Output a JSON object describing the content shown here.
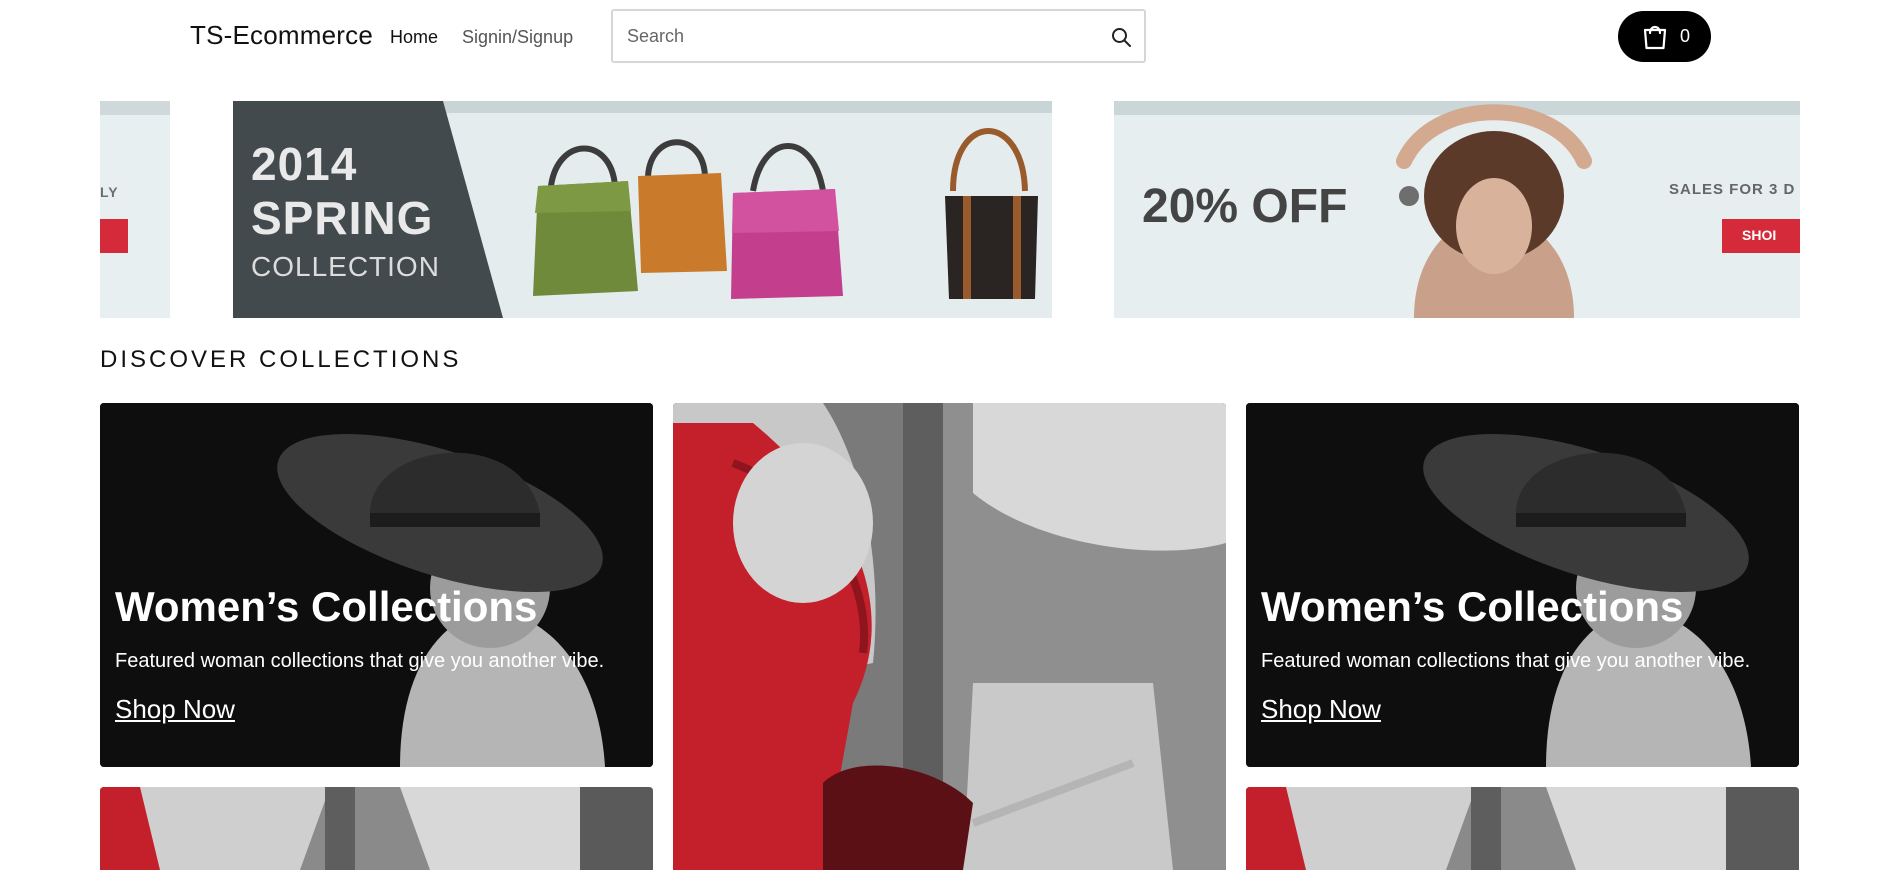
{
  "header": {
    "brand": "TS-Ecommerce",
    "nav": {
      "home": "Home",
      "signin": "Signin/Signup"
    },
    "search": {
      "placeholder": "Search",
      "icon": "search-icon"
    },
    "cart": {
      "count": "0",
      "icon": "shopping-bag-icon"
    }
  },
  "carousel": {
    "slides": [
      {
        "visible_text": "LY"
      },
      {
        "line1": "2014",
        "line2": "SPRING",
        "line3": "COLLECTION"
      },
      {
        "headline": "20% OFF",
        "tagline": "SALES FOR 3 D",
        "button": "SHOI"
      }
    ]
  },
  "section": {
    "title": "DISCOVER COLLECTIONS"
  },
  "cards": [
    {
      "title": "Women’s Collections",
      "description": "Featured woman collections that give you another vibe.",
      "cta": "Shop Now"
    },
    {
      "title": "Women’s Collections",
      "description": "Featured woman collections that give you another vibe.",
      "cta": "Shop Now"
    }
  ],
  "colors": {
    "accent": "#d42a3a",
    "cart_bg": "#000000",
    "panel_dark": "#434a4e"
  }
}
